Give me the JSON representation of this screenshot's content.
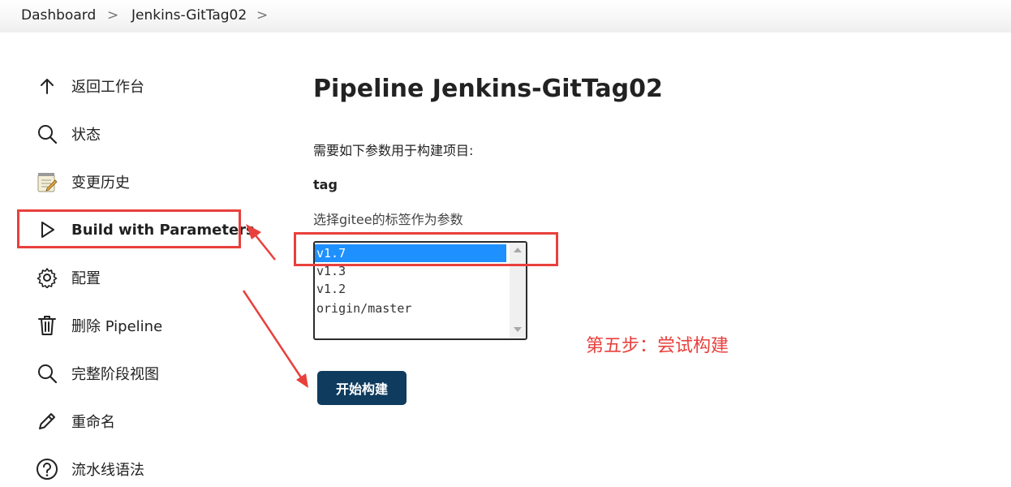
{
  "breadcrumb": {
    "items": [
      "Dashboard",
      "Jenkins-GitTag02"
    ],
    "separator": ">"
  },
  "sidebar": {
    "items": [
      {
        "label": "返回工作台",
        "icon": "arrow-up-icon"
      },
      {
        "label": "状态",
        "icon": "search-icon"
      },
      {
        "label": "变更历史",
        "icon": "notepad-icon"
      },
      {
        "label": "Build with Parameters",
        "icon": "play-icon"
      },
      {
        "label": "配置",
        "icon": "gear-icon"
      },
      {
        "label": "删除 Pipeline",
        "icon": "trash-icon"
      },
      {
        "label": "完整阶段视图",
        "icon": "search-icon"
      },
      {
        "label": "重命名",
        "icon": "pencil-icon"
      },
      {
        "label": "流水线语法",
        "icon": "help-icon"
      }
    ]
  },
  "main": {
    "title": "Pipeline Jenkins-GitTag02",
    "description": "需要如下参数用于构建项目:",
    "parameter": {
      "name": "tag",
      "description": "选择gitee的标签作为参数",
      "options": [
        "v1.7",
        "v1.3",
        "v1.2",
        "origin/master"
      ],
      "selected": "v1.7"
    },
    "build_button": "开始构建"
  },
  "annotation": {
    "text": "第五步：尝试构建",
    "color": "#e8403c"
  },
  "colors": {
    "accent": "#0e3b5e",
    "selection": "#1e90ff",
    "annotation_red": "#e8403c"
  }
}
